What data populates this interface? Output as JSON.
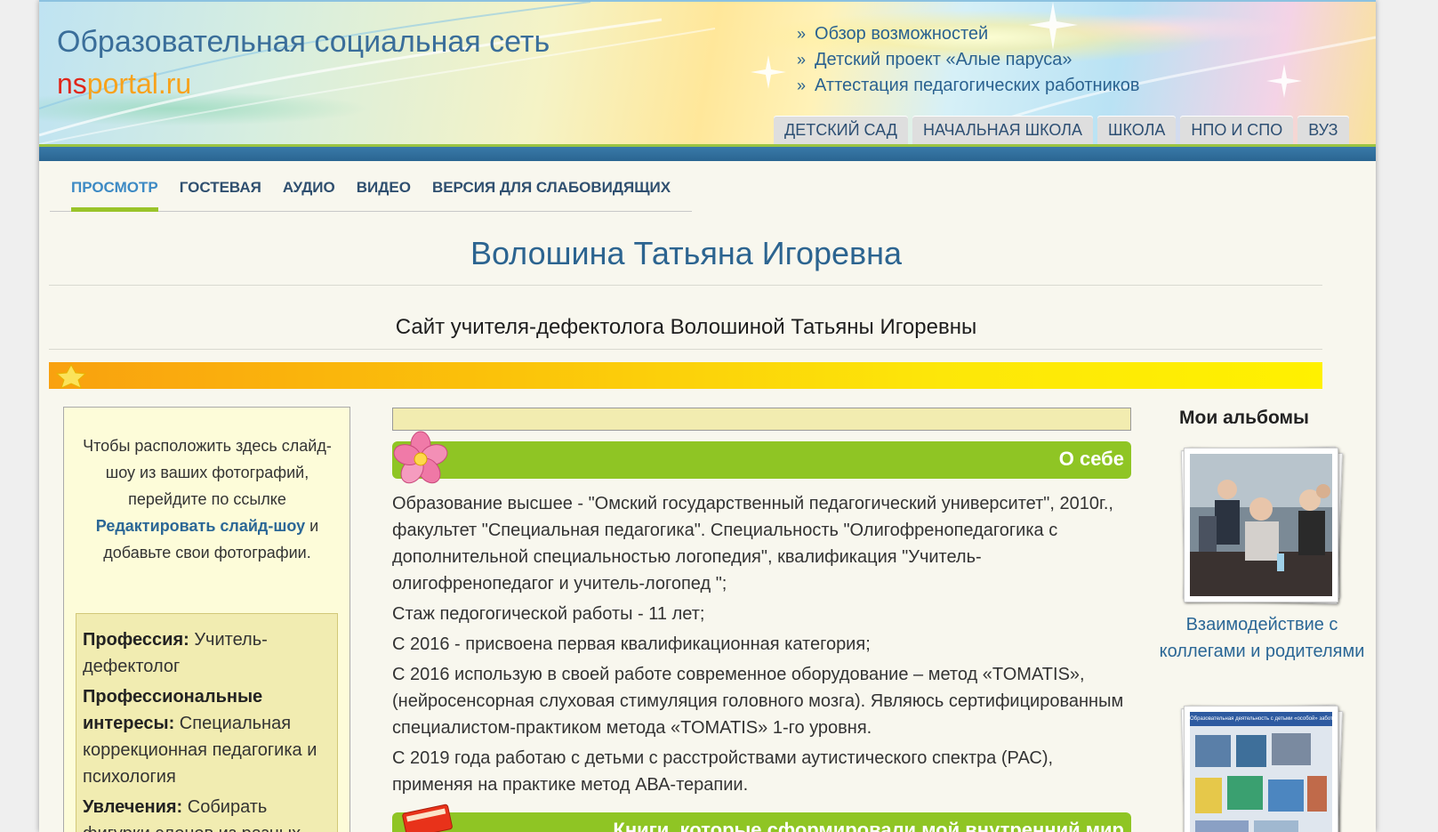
{
  "header": {
    "site_title": "Образовательная социальная сеть",
    "logo_ns": "ns",
    "logo_portal": "portal.ru",
    "top_links": [
      {
        "label": "Обзор возможностей"
      },
      {
        "label": "Детский проект «Алые паруса»"
      },
      {
        "label": "Аттестация педагогических работников"
      }
    ],
    "level_tabs": [
      {
        "label": "ДЕТСКИЙ САД"
      },
      {
        "label": "НАЧАЛЬНАЯ ШКОЛА"
      },
      {
        "label": "ШКОЛА"
      },
      {
        "label": "НПО И СПО"
      },
      {
        "label": "ВУЗ"
      }
    ]
  },
  "nav": {
    "tabs": [
      {
        "label": "ПРОСМОТР",
        "active": true
      },
      {
        "label": "ГОСТЕВАЯ"
      },
      {
        "label": "АУДИО"
      },
      {
        "label": "ВИДЕО"
      },
      {
        "label": "ВЕРСИЯ ДЛЯ СЛАБОВИДЯЩИХ"
      }
    ]
  },
  "profile": {
    "name": "Волошина Татьяна Игоревна",
    "subtitle": "Сайт учителя-дефектолога Волошиной Татьяны Игоревны"
  },
  "sidebar": {
    "note_before": "Чтобы расположить здесь слайд-шоу из ваших фотографий, перейдите по ссылке ",
    "note_link": "Редактировать слайд-шоу",
    "note_after": " и добавьте свои фотографии.",
    "profession_label": "Профессия:",
    "profession_value": " Учитель-дефектолог",
    "interests_label": "Профессиональные интересы:",
    "interests_value": " Специальная коррекционная педагогика и психология",
    "hobbies_label": "Увлечения:",
    "hobbies_value": " Собирать фигурки слонов из разных"
  },
  "about": {
    "title": "О себе",
    "paragraphs": [
      "Образование высшее - \"Омский государственный педагогический университет\", 2010г., факультет \"Специальная педагогика\". Специальность \"Олигофренопедагогика с дополнительной специальностью логопедия\", квалификация \"Учитель-олигофренопедагог и учитель-логопед \";",
      "Стаж педогогической работы - 11 лет;",
      "С 2016 - присвоена первая квалификационная категория;",
      "С 2016 использую в своей работе современное оборудование – метод «TOMATIS», (нейросенсорная слуховая стимуляция головного мозга). Являюсь сертифицированным специалистом-практиком метода «TOMATIS» 1-го уровня.",
      "С 2019 года работаю с детьми с расстройствами аутистического спектра (РАС), применяя на практике метод АВА-терапии."
    ]
  },
  "books": {
    "title": "Книги, которые сформировали мой внутренний мир"
  },
  "albums": {
    "title": "Мои альбомы",
    "items": [
      {
        "caption": "Взаимодействие с коллегами и родителями"
      },
      {
        "poster_heading": "Образовательная деятельность с детьми «особой» заботы"
      }
    ]
  },
  "colors": {
    "link_blue": "#2b6796",
    "section_green": "#8fc524",
    "active_tab_underline": "#9ac42a",
    "band_blue": "#2a6592"
  }
}
